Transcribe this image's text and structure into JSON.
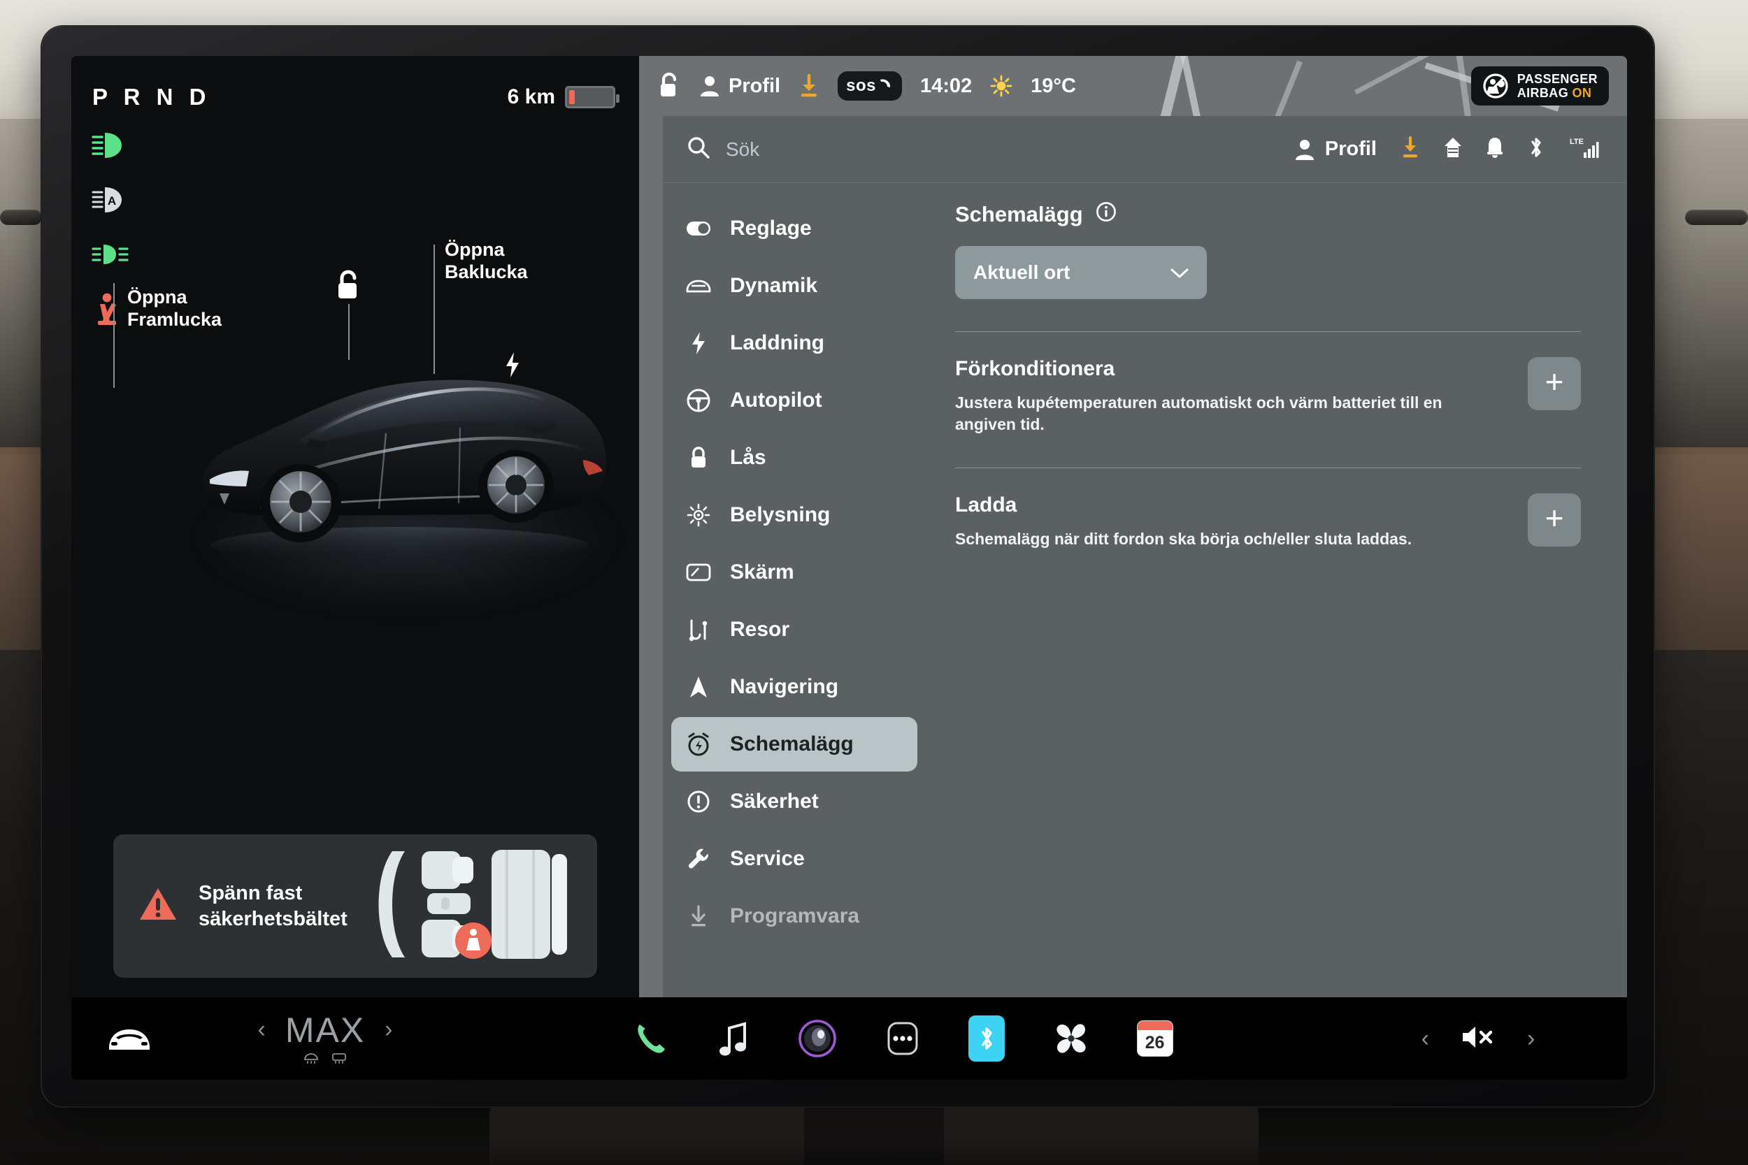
{
  "driver_panel": {
    "gear_indicator": "P R N D",
    "range_value": "6 km",
    "telltales": [
      {
        "name": "high-beam-icon",
        "color": "#5ce08a"
      },
      {
        "name": "auto-high-beam-icon",
        "color": "#d8dde0"
      },
      {
        "name": "fog-light-icon",
        "color": "#5ce08a"
      },
      {
        "name": "seatbelt-warning-icon",
        "color": "#ef6a58"
      }
    ],
    "callouts": {
      "front_trunk": "Öppna\nFramlucka",
      "front_trunk_line1": "Öppna",
      "front_trunk_line2": "Framlucka",
      "rear_trunk_line1": "Öppna",
      "rear_trunk_line2": "Baklucka"
    },
    "belt_warning": {
      "line1": "Spänn fast",
      "line2": "säkerhetsbältet"
    }
  },
  "status_bar": {
    "lock_icon": "unlock-icon",
    "profile_label": "Profil",
    "download_icon": "software-download-icon",
    "sos_label": "sos",
    "time": "14:02",
    "weather_icon": "sun-icon",
    "temperature": "19°C",
    "airbag": {
      "line1": "PASSENGER",
      "line2_prefix": "AIRBAG",
      "line2_state": "ON"
    }
  },
  "settings": {
    "search_placeholder": "Sök",
    "header_profile": "Profil",
    "header_icons": [
      "software-download-icon",
      "home-icon",
      "bell-icon",
      "bluetooth-icon",
      "lte-signal-icon"
    ],
    "lte_label": "LTE",
    "sidebar": [
      {
        "label": "Reglage",
        "icon": "toggle-icon",
        "active": false,
        "faded": false
      },
      {
        "label": "Dynamik",
        "icon": "car-icon",
        "active": false,
        "faded": false
      },
      {
        "label": "Laddning",
        "icon": "bolt-icon",
        "active": false,
        "faded": false
      },
      {
        "label": "Autopilot",
        "icon": "steering-wheel-icon",
        "active": false,
        "faded": false
      },
      {
        "label": "Lås",
        "icon": "lock-icon",
        "active": false,
        "faded": false
      },
      {
        "label": "Belysning",
        "icon": "brightness-icon",
        "active": false,
        "faded": false
      },
      {
        "label": "Skärm",
        "icon": "display-icon",
        "active": false,
        "faded": false
      },
      {
        "label": "Resor",
        "icon": "trips-icon",
        "active": false,
        "faded": false
      },
      {
        "label": "Navigering",
        "icon": "navigation-arrow-icon",
        "active": false,
        "faded": false
      },
      {
        "label": "Schemalägg",
        "icon": "alarm-clock-icon",
        "active": true,
        "faded": false
      },
      {
        "label": "Säkerhet",
        "icon": "warning-circle-icon",
        "active": false,
        "faded": false
      },
      {
        "label": "Service",
        "icon": "wrench-icon",
        "active": false,
        "faded": false
      },
      {
        "label": "Programvara",
        "icon": "download-icon",
        "active": false,
        "faded": true
      }
    ],
    "content": {
      "title": "Schemalägg",
      "info_icon": "info-icon",
      "location_select": "Aktuell ort",
      "chevron": "chevron-down-icon",
      "sections": [
        {
          "heading": "Förkonditionera",
          "description": "Justera kupétemperaturen automatiskt och värm batteriet till en angiven tid.",
          "add_label": "+"
        },
        {
          "heading": "Ladda",
          "description": "Schemalägg när ditt fordon ska börja och/eller sluta laddas.",
          "add_label": "+"
        }
      ]
    }
  },
  "taskbar": {
    "car_icon": "car-icon",
    "climate": {
      "prev": "‹",
      "value": "MAX",
      "next": "›",
      "defrost_icons": [
        "rear-defrost-icon",
        "front-defrost-icon"
      ]
    },
    "apps": [
      {
        "name": "phone-icon"
      },
      {
        "name": "music-icon"
      },
      {
        "name": "media-player-icon"
      },
      {
        "name": "more-apps-icon"
      },
      {
        "name": "bluetooth-icon"
      },
      {
        "name": "climate-fan-icon"
      },
      {
        "name": "calendar-icon",
        "day": "26"
      }
    ],
    "volume": {
      "prev": "‹",
      "icon": "volume-muted-icon",
      "next": "›"
    }
  },
  "colors": {
    "accent_green": "#5ce08a",
    "warning_red": "#ef6a58",
    "amber": "#f0a62a",
    "bluetooth_blue": "#3ed3f5",
    "panel_bg": "#5b6063",
    "active_pill": "#b9c4c6"
  }
}
